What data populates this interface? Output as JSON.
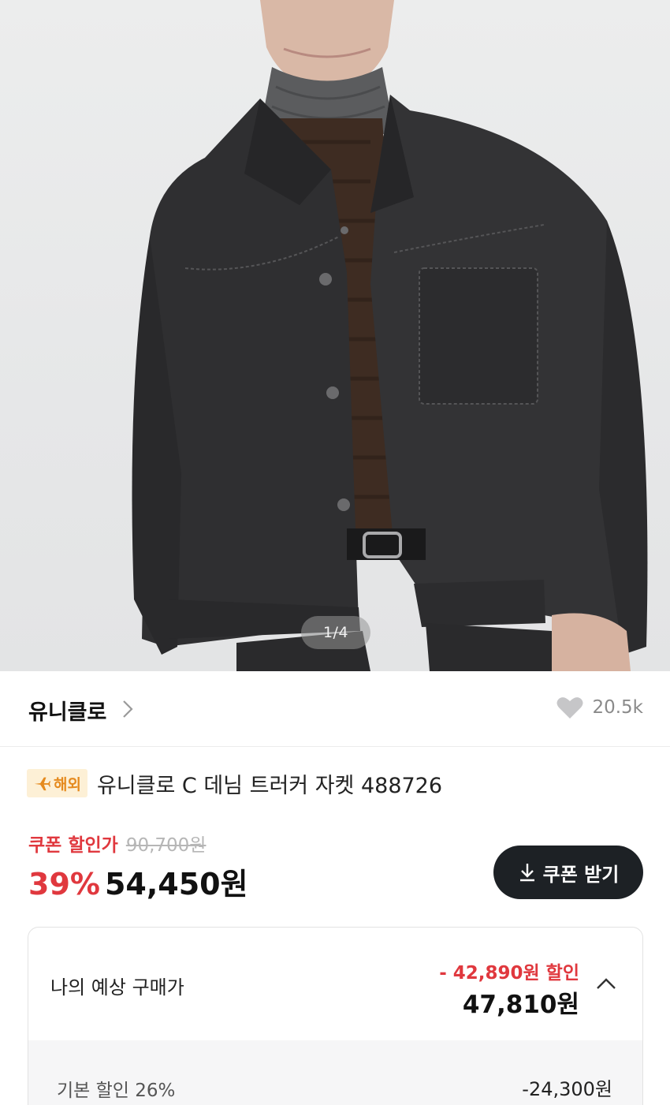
{
  "gallery": {
    "pager": "1/4"
  },
  "brand": {
    "name": "유니클로",
    "likes": "20.5k"
  },
  "product": {
    "badge": "해외",
    "title": "유니클로 C 데님 트러커 자켓 488726"
  },
  "price": {
    "coupon_label": "쿠폰 할인가",
    "original": "90,700원",
    "discount_rate": "39%",
    "sale": "54,450원",
    "coupon_button": "쿠폰 받기"
  },
  "estimate": {
    "label": "나의 예상 구매가",
    "discount": "- 42,890원 할인",
    "price": "47,810원",
    "rows": [
      {
        "label": "기본 할인 26%",
        "value": "-24,300원"
      }
    ]
  },
  "colors": {
    "accent_red": "#e0383e",
    "button_dark": "#1d2125",
    "badge_bg": "#fdf0d6",
    "badge_fg": "#e58a1e"
  },
  "icons": [
    "chevron-right-icon",
    "heart-icon",
    "airplane-icon",
    "download-icon",
    "chevron-up-icon"
  ]
}
